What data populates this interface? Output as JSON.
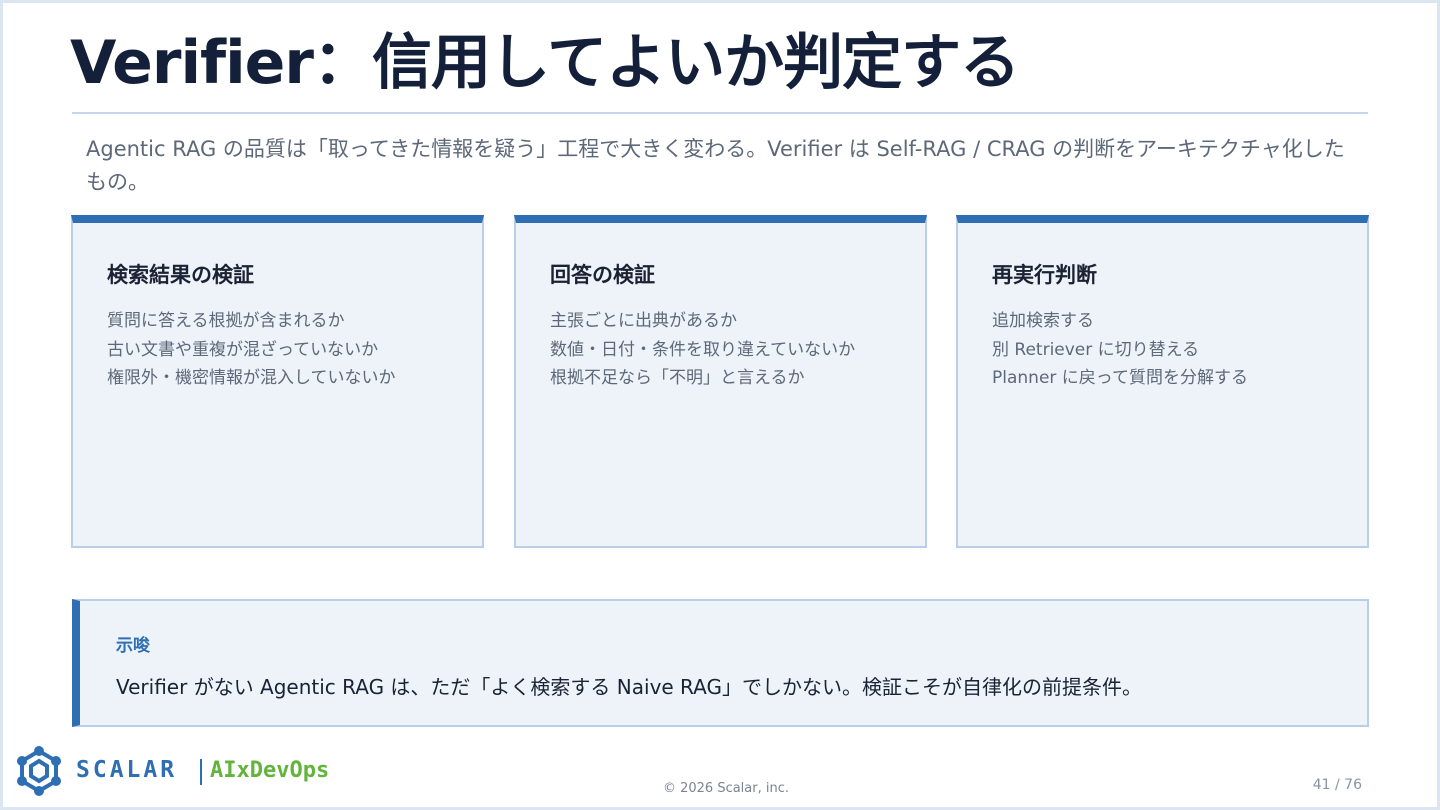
{
  "slide": {
    "title": "Verifier：信用してよいか判定する",
    "subtitle": "Agentic RAG の品質は「取ってきた情報を疑う」工程で大きく変わる。Verifier は Self-RAG / CRAG の判断をアーキテクチャ化したもの。"
  },
  "cards": [
    {
      "title": "検索結果の検証",
      "lines": [
        "質問に答える根拠が含まれるか",
        "古い文書や重複が混ざっていないか",
        "権限外・機密情報が混入していないか"
      ]
    },
    {
      "title": "回答の検証",
      "lines": [
        "主張ごとに出典があるか",
        "数値・日付・条件を取り違えていないか",
        "根拠不足なら「不明」と言えるか"
      ]
    },
    {
      "title": "再実行判断",
      "lines": [
        "追加検索する",
        "別 Retriever に切り替える",
        "Planner に戻って質問を分解する"
      ]
    }
  ],
  "callout": {
    "label": "示唆",
    "text": "Verifier がない Agentic RAG は、ただ「よく検索する Naive RAG」でしかない。検証こそが自律化の前提条件。"
  },
  "footer": {
    "logo_name": "SCALAR",
    "logo_sub": "AIxDevOps",
    "copyright": "© 2026 Scalar, inc.",
    "page": "41 / 76"
  },
  "colors": {
    "accent": "#2e6fb4",
    "card_bg": "#eef3fa",
    "logo_green": "#62b43c"
  },
  "icons": {
    "logo": "scalar-logo-icon"
  }
}
